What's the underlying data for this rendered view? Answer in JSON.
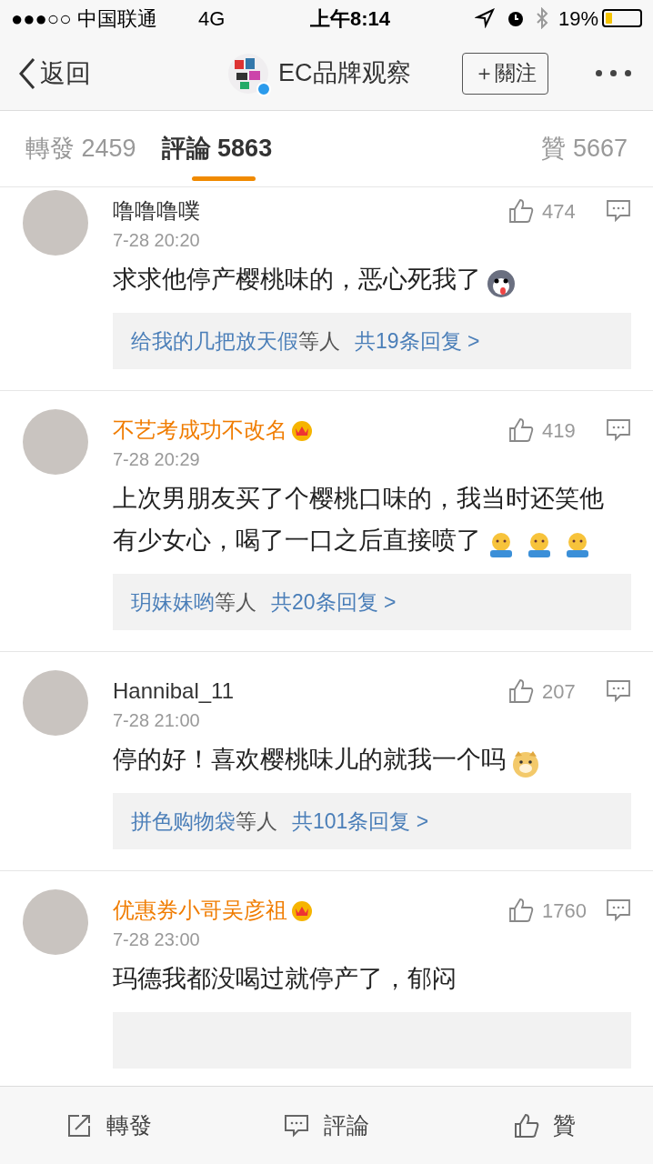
{
  "status_bar": {
    "carrier": "●●●○○ 中国联通",
    "network": "4G",
    "time": "上午8:14",
    "battery": "19%"
  },
  "nav": {
    "back": "返回",
    "title": "EC品牌观察",
    "verified": true,
    "follow": "＋關注"
  },
  "tabs": [
    {
      "label": "轉發",
      "count": "2459",
      "selected": false
    },
    {
      "label": "評論",
      "count": "5863",
      "selected": true
    },
    {
      "label": "贊",
      "count": "5667",
      "selected": false
    }
  ],
  "comments": [
    {
      "name": "噜噜噜噗",
      "vip": false,
      "time": "7-28 20:20",
      "likes": "474",
      "text": "求求他停产樱桃味的，恶心死我了",
      "emojis": [
        {
          "kind": "husky"
        }
      ],
      "reply": {
        "user": "给我的几把放天假",
        "suffix": "等人",
        "count": "共19条回复 >"
      }
    },
    {
      "name": "不艺考成功不改名",
      "vip": true,
      "time": "7-28 20:29",
      "likes": "419",
      "text": "上次男朋友买了个樱桃口味的，我当时还笑他有少女心，喝了一口之后直接喷了",
      "emojis": [
        {
          "kind": "shrug"
        },
        {
          "kind": "shrug"
        },
        {
          "kind": "shrug"
        }
      ],
      "reply": {
        "user": "玥妹妹哟",
        "suffix": "等人",
        "count": "共20条回复 >"
      }
    },
    {
      "name": "Hannibal_11",
      "vip": false,
      "time": "7-28 21:00",
      "likes": "207",
      "text": "停的好！喜欢樱桃味儿的就我一个吗",
      "emojis": [
        {
          "kind": "doge"
        }
      ],
      "reply": {
        "user": "拼色购物袋",
        "suffix": "等人",
        "count": "共101条回复 >"
      }
    },
    {
      "name": "优惠券小哥吴彦祖",
      "vip": true,
      "time": "7-28 23:00",
      "likes": "1760",
      "text": "玛德我都没喝过就停产了，郁闷",
      "reply_cut_off": true
    }
  ],
  "actions": [
    {
      "kind": "repost",
      "label": "轉發"
    },
    {
      "kind": "comment",
      "label": "評論"
    },
    {
      "kind": "like",
      "label": "贊"
    }
  ]
}
